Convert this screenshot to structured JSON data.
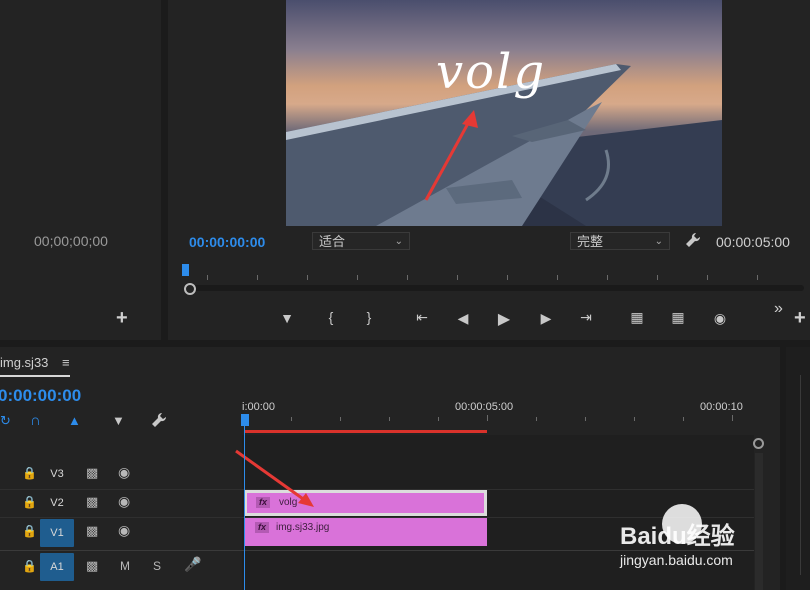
{
  "source_monitor": {
    "timecode": "00;00;00;00",
    "add_symbol": "+"
  },
  "program_monitor": {
    "overlay_text": "volg",
    "timecode_current": "00:00:00:00",
    "fit_dropdown": "适合",
    "quality_dropdown": "完整",
    "timecode_duration": "00:00:05:00",
    "more_symbol": "»",
    "add_symbol": "+"
  },
  "timeline": {
    "sequence_name": "img.sj33",
    "menu_symbol": "≡",
    "timecode": "0:00:00:00",
    "ruler_labels": [
      "i:00:00",
      "00:00:05:00",
      "00:00:10"
    ],
    "tracks": [
      {
        "label": "V3",
        "clip": null
      },
      {
        "label": "V2",
        "clip": {
          "name": "volg",
          "badge": "fx"
        }
      },
      {
        "label": "V1",
        "clip": {
          "name": "img.sj33.jpg",
          "badge": "fx"
        }
      },
      {
        "label": "A1",
        "extra": [
          "M",
          "S"
        ]
      }
    ]
  },
  "watermark": {
    "brand": "Baidu经验",
    "url": "jingyan.baidu.com"
  },
  "colors": {
    "accent_blue": "#2d8ceb",
    "clip_pink": "#d972d9",
    "render_bar_red": "#d9322b",
    "arrow_red": "#e53935"
  }
}
